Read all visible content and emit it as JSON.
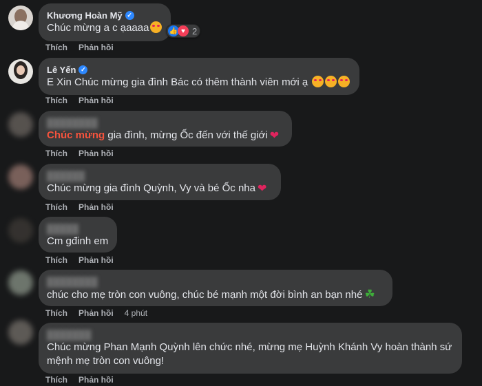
{
  "actions": {
    "like": "Thích",
    "reply": "Phản hồi"
  },
  "comments": [
    {
      "name": "Khương Hoàn Mỹ",
      "text": "Chúc mừng a c ạaaaa",
      "reaction_count": "2",
      "time": ""
    },
    {
      "name": "Lê Yến",
      "text": "E Xin Chúc mừng gia đình Bác có thêm thành viên mới ạ",
      "time": ""
    },
    {
      "name": "",
      "highlight": "Chúc mừng",
      "text": " gia đình, mừng Ốc đến với thế giới",
      "time": ""
    },
    {
      "name": "",
      "text": "Chúc mừng gia đình Quỳnh, Vy và bé Ốc nha",
      "time": ""
    },
    {
      "name": "",
      "text": "Cm gđinh em",
      "time": ""
    },
    {
      "name": "",
      "text": "chúc cho mẹ tròn con vuông, chúc bé mạnh một đời bình an bạn nhé",
      "time": "4 phút"
    },
    {
      "name": "",
      "text": "Chúc mừng Phan Mạnh Quỳnh lên chức nhé, mừng mẹ Huỳnh Khánh Vy hoàn thành sứ mệnh mẹ tròn con vuông!",
      "time": ""
    }
  ]
}
